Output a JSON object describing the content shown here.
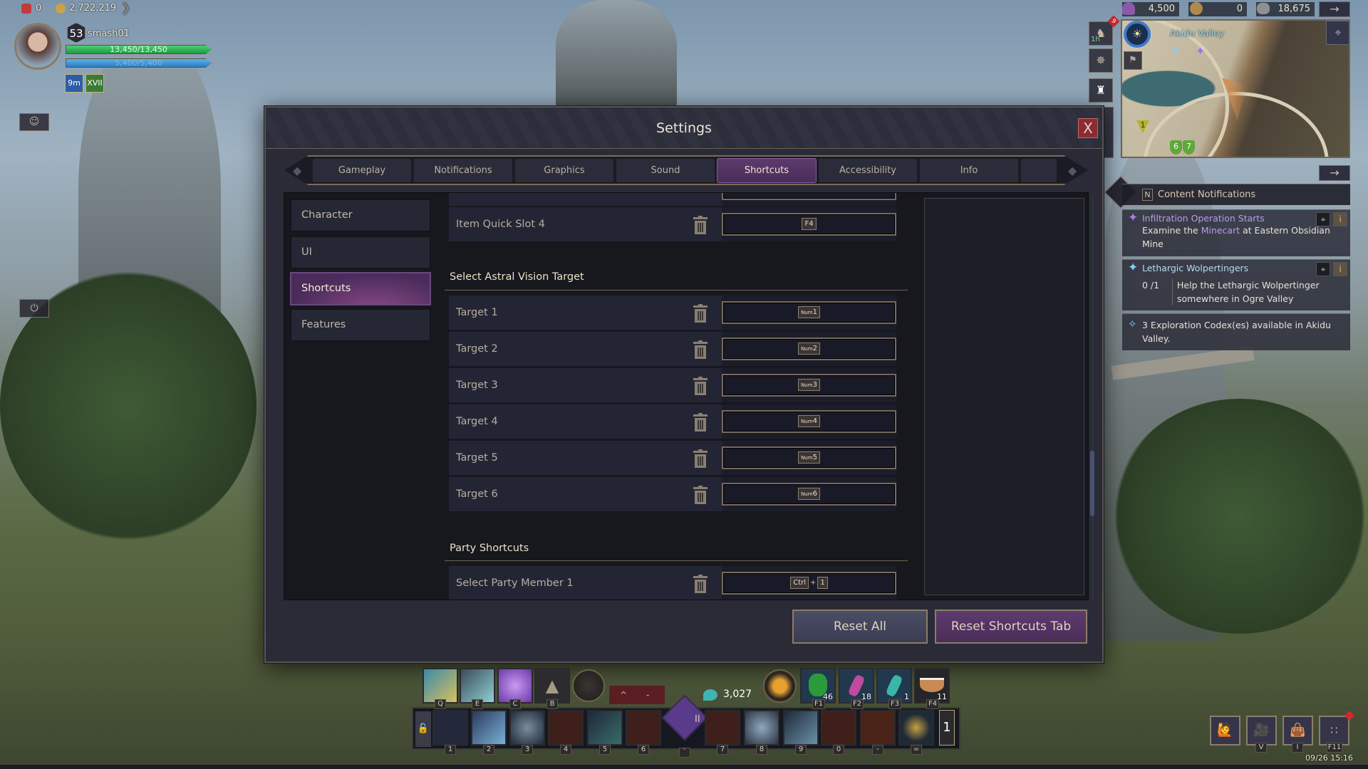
{
  "hud": {
    "currencies": [
      {
        "icon": "gem-icon",
        "value": "0"
      },
      {
        "icon": "gold-coin-icon",
        "value": "2,722,219"
      }
    ],
    "player": {
      "level": "53",
      "name": "smash01",
      "hp": "13,450/13,450",
      "hp_fill": 1.0,
      "mp": "5,400/5,400",
      "mp_fill": 1.0
    },
    "buffs": [
      {
        "icon": "bow-buff-icon",
        "label": "9m"
      },
      {
        "icon": "roman-xvii-buff-icon",
        "label": "XVII"
      }
    ],
    "top_right_currencies": [
      {
        "icon": "hooded-figure-icon",
        "value": "4,500"
      },
      {
        "icon": "lion-crest-icon",
        "value": "0"
      },
      {
        "icon": "horned-helmet-icon",
        "value": "18,675"
      }
    ],
    "minimap": {
      "location": "Akidu Valley",
      "markers": [
        "1",
        "6",
        "7"
      ],
      "mount_timer": "1h",
      "mount_badge": "9"
    },
    "notifications": {
      "hotkey": "N",
      "title": "Content Notifications",
      "items": [
        {
          "title": "Infiltration Operation Starts",
          "text_before": "Examine the ",
          "highlight": "Minecart",
          "text_after": " at Eastern Obsidian Mine"
        },
        {
          "title": "Lethargic Wolpertingers",
          "progress": "0 /1",
          "text": "Help the Lethargic Wolpertinger somewhere in Ogre Valley"
        },
        {
          "text": "3 Exploration Codex(es) available in Akidu Valley."
        }
      ]
    },
    "hotbar": {
      "top_keys": [
        "Q",
        "E",
        "C",
        "B"
      ],
      "bottom_keys": [
        "1",
        "2",
        "3",
        "4",
        "5",
        "6",
        "`",
        "7",
        "8",
        "9",
        "0",
        "-",
        "="
      ],
      "consumables": [
        {
          "key": "F1",
          "count": "46",
          "color": "#2a9a3a"
        },
        {
          "key": "F2",
          "count": "18",
          "color": "#c04aa0"
        },
        {
          "key": "F3",
          "count": "1",
          "color": "#3ab6a8"
        },
        {
          "key": "F4",
          "count": "11",
          "color": "#c88a50"
        }
      ],
      "resource": "3,027",
      "gauge_symbols": [
        "^",
        "-"
      ],
      "stance": "II",
      "page": "1"
    },
    "bottom_buttons": [
      {
        "icon": "emote-icon",
        "key": ""
      },
      {
        "icon": "camera-icon",
        "key": "V"
      },
      {
        "icon": "inventory-icon",
        "key": "I"
      },
      {
        "icon": "grid-menu-icon",
        "key": "F11"
      }
    ],
    "clock": "09/26 15:16"
  },
  "settings": {
    "title": "Settings",
    "close_label": "X",
    "tabs": [
      "Gameplay",
      "Notifications",
      "Graphics",
      "Sound",
      "Shortcuts",
      "Accessibility",
      "Info"
    ],
    "active_tab": "Shortcuts",
    "side_nav": [
      "Character",
      "UI",
      "Shortcuts",
      "Features"
    ],
    "active_side_nav": "Shortcuts",
    "rows_top": [
      {
        "label": "Item Quick Slot 4",
        "keys": [
          {
            "prefix": "",
            "key": "F4"
          }
        ]
      }
    ],
    "section_astral": {
      "title": "Select Astral Vision Target",
      "rows": [
        {
          "label": "Target 1",
          "prefix": "Num",
          "key": "1"
        },
        {
          "label": "Target 2",
          "prefix": "Num",
          "key": "2"
        },
        {
          "label": "Target 3",
          "prefix": "Num",
          "key": "3"
        },
        {
          "label": "Target 4",
          "prefix": "Num",
          "key": "4"
        },
        {
          "label": "Target 5",
          "prefix": "Num",
          "key": "5"
        },
        {
          "label": "Target 6",
          "prefix": "Num",
          "key": "6"
        }
      ]
    },
    "section_party": {
      "title": "Party Shortcuts",
      "rows": [
        {
          "label": "Select Party Member 1",
          "modifier": "Ctrl",
          "plus": "+",
          "key": "1"
        }
      ]
    },
    "reset_all": "Reset All",
    "reset_tab": "Reset Shortcuts Tab",
    "colors": {
      "accent_purple": "#5e3a6e",
      "close_red": "#8a2c31",
      "panel": "#2a2b37"
    }
  }
}
